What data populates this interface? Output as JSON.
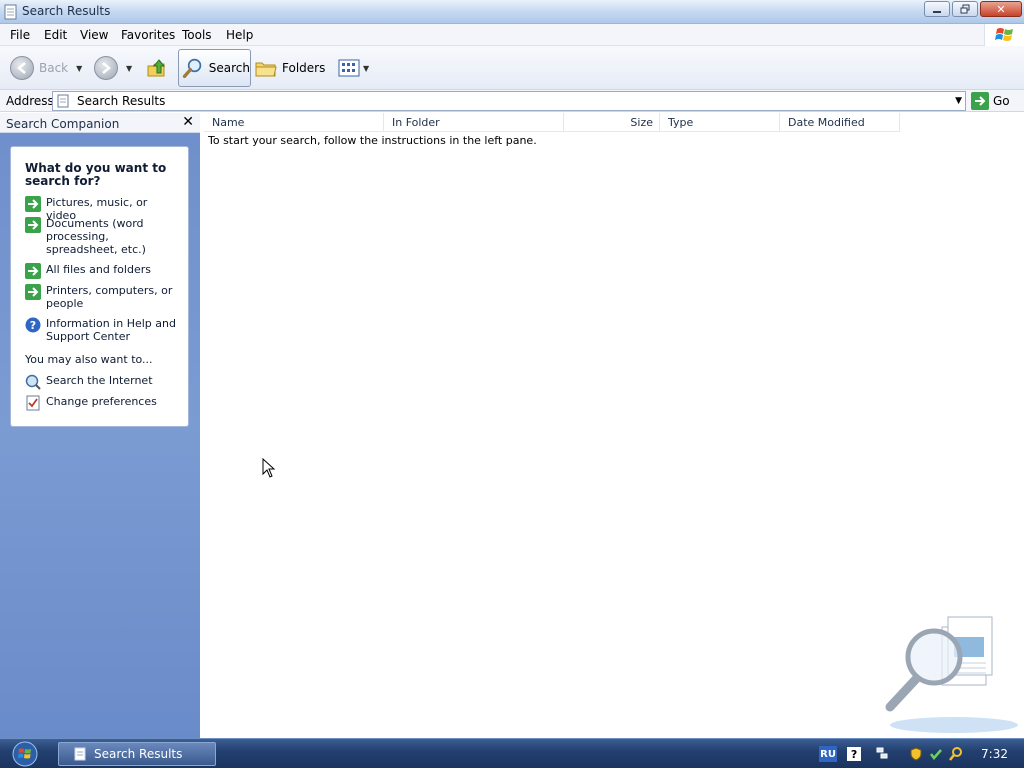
{
  "window": {
    "title": "Search Results",
    "controls": {
      "close_glyph": "✕"
    }
  },
  "menu": {
    "items": [
      "File",
      "Edit",
      "View",
      "Favorites",
      "Tools",
      "Help"
    ]
  },
  "toolbar": {
    "back_label": "Back",
    "search_label": "Search",
    "folders_label": "Folders"
  },
  "address": {
    "label": "Address",
    "value": "Search Results",
    "go_label": "Go"
  },
  "search_companion": {
    "title": "Search Companion",
    "close_glyph": "✕",
    "question": "What do you want to search for?",
    "options": [
      {
        "label": "Pictures, music, or video",
        "icon": "green-arrow-icon"
      },
      {
        "label": "Documents (word processing, spreadsheet, etc.)",
        "icon": "green-arrow-icon"
      },
      {
        "label": "All files and folders",
        "icon": "green-arrow-icon"
      },
      {
        "label": "Printers, computers, or people",
        "icon": "green-arrow-icon"
      },
      {
        "label": "Information in Help and Support Center",
        "icon": "help-icon"
      }
    ],
    "also_heading": "You may also want to...",
    "also_options": [
      {
        "label": "Search the Internet",
        "icon": "internet-search-icon"
      },
      {
        "label": "Change preferences",
        "icon": "preferences-icon"
      }
    ]
  },
  "results": {
    "columns": [
      "Name",
      "In Folder",
      "Size",
      "Type",
      "Date Modified"
    ],
    "instructions": "To start your search, follow the instructions in the left pane."
  },
  "taskbar": {
    "task_label": "Search Results",
    "language": "RU",
    "help_glyph": "?",
    "clock": "7:32"
  },
  "colors": {
    "left_pane": "#7b9bd3",
    "taskbar": "#23406f",
    "go_green": "#3aa24a"
  }
}
